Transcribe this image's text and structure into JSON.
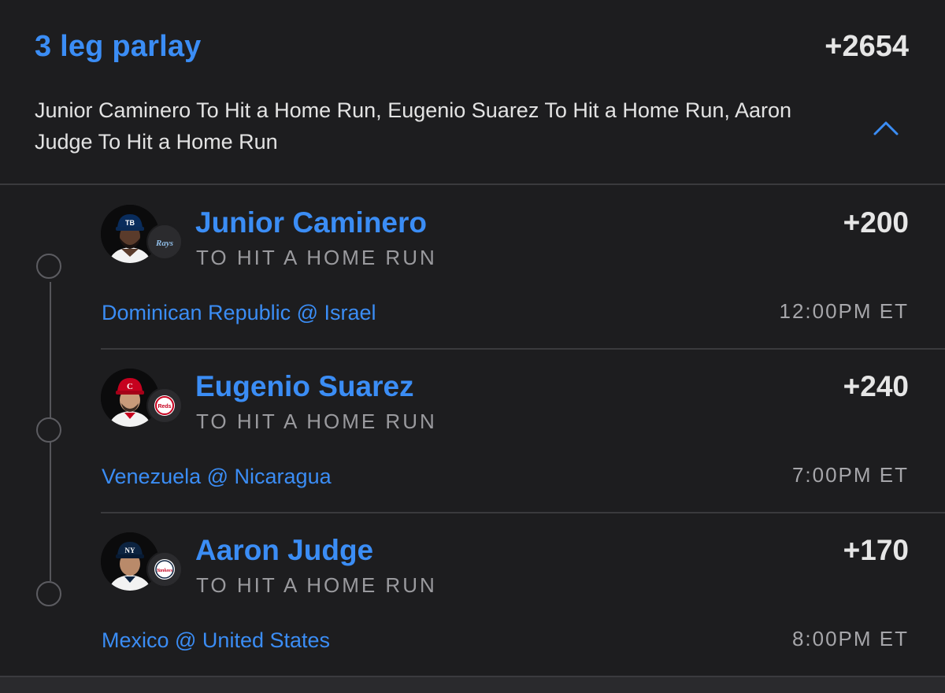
{
  "header": {
    "title": "3 leg parlay",
    "odds": "+2654",
    "summary": "Junior Caminero To Hit a Home Run, Eugenio Suarez To Hit a Home Run, Aaron Judge To Hit a Home Run",
    "collapse_icon": "chevron-up-icon"
  },
  "legs": [
    {
      "player": "Junior Caminero",
      "market": "TO HIT A HOME RUN",
      "odds": "+200",
      "matchup": "Dominican Republic @ Israel",
      "time": "12:00PM ET",
      "team": "Rays",
      "cap_text": "TB",
      "team_color": "#092c5c"
    },
    {
      "player": "Eugenio Suarez",
      "market": "TO HIT A HOME RUN",
      "odds": "+240",
      "matchup": "Venezuela @ Nicaragua",
      "time": "7:00PM ET",
      "team": "Reds",
      "cap_text": "C",
      "team_color": "#c6011f"
    },
    {
      "player": "Aaron Judge",
      "market": "TO HIT A HOME RUN",
      "odds": "+170",
      "matchup": "Mexico @ United States",
      "time": "8:00PM ET",
      "team": "Yankees",
      "cap_text": "NY",
      "team_color": "#0c2340"
    }
  ],
  "colors": {
    "accent": "#3b8df5",
    "background": "#1d1d1f",
    "odds_text": "#e6e6e6",
    "muted_text": "#9a9a9e",
    "divider": "#3a3a3d"
  }
}
